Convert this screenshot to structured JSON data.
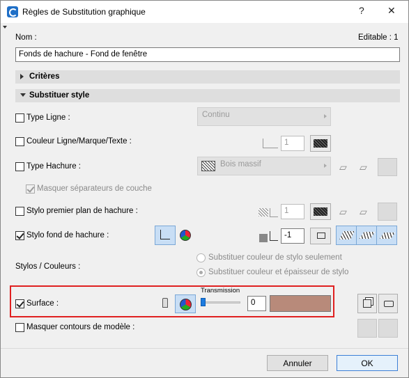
{
  "window": {
    "title": "Règles de Substitution graphique",
    "help": "?",
    "close": "✕"
  },
  "name_label": "Nom :",
  "editable": "Editable : 1",
  "name_value": "Fonds de hachure  - Fond de fenêtre",
  "sections": {
    "criteria": "Critères",
    "override": "Substituer style"
  },
  "rows": {
    "line_type": {
      "label": "Type Ligne :",
      "value": "Continu"
    },
    "line_color": {
      "label": "Couleur Ligne/Marque/Texte :",
      "pen": "1"
    },
    "fill_type": {
      "label": "Type Hachure :",
      "value": "Bois massif"
    },
    "hide_sep": {
      "label": "Masquer séparateurs de couche"
    },
    "fg_pen": {
      "label": "Stylo premier plan de hachure :",
      "pen": "1"
    },
    "bg_pen": {
      "label": "Stylo fond de hachure :",
      "pen": "-1"
    },
    "pens_colors": {
      "label": "Stylos / Couleurs :",
      "opt1": "Substituer couleur de stylo seulement",
      "opt2": "Substituer couleur et épaisseur de stylo"
    },
    "surface": {
      "label": "Surface :",
      "transmission_label": "Transmission",
      "transmission_value": "0",
      "color": "#b88a7a"
    },
    "hide_contours": {
      "label": "Masquer contours de modèle :"
    }
  },
  "buttons": {
    "cancel": "Annuler",
    "ok": "OK"
  },
  "colors": {
    "section_bg": "#dedede",
    "selected_btn": "#c8def5",
    "highlight_border": "#e02020"
  }
}
